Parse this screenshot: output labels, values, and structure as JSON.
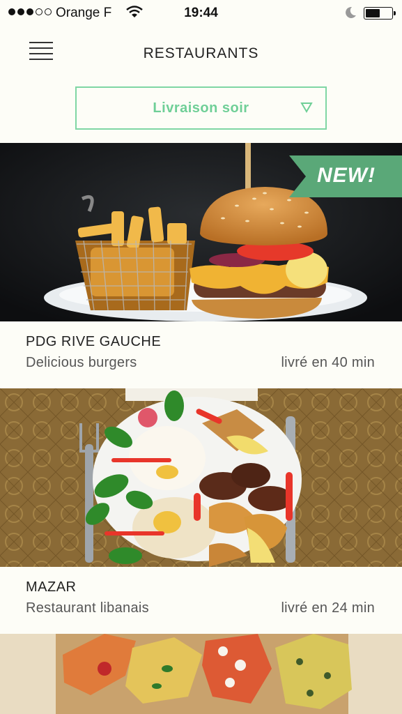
{
  "status_bar": {
    "carrier": "Orange F",
    "time": "19:44",
    "signal_bars_filled": 3,
    "signal_bars_total": 5,
    "battery_level": 0.55
  },
  "header": {
    "title": "RESTAURANTS",
    "menu_icon": "hamburger-icon"
  },
  "filter": {
    "selected": "Livraison soir",
    "icon": "triangle-down-icon",
    "accent_color": "#6fcf97"
  },
  "restaurants": [
    {
      "name": "PDG RIVE GAUCHE",
      "description": "Delicious burgers",
      "delivery": "livré en 40 min",
      "badge": "NEW!",
      "image": "burger-and-fries-photo"
    },
    {
      "name": "MAZAR",
      "description": "Restaurant libanais",
      "delivery": "livré en 24 min",
      "image": "lebanese-mezze-plate-photo"
    },
    {
      "image": "pizza-squares-photo"
    }
  ]
}
